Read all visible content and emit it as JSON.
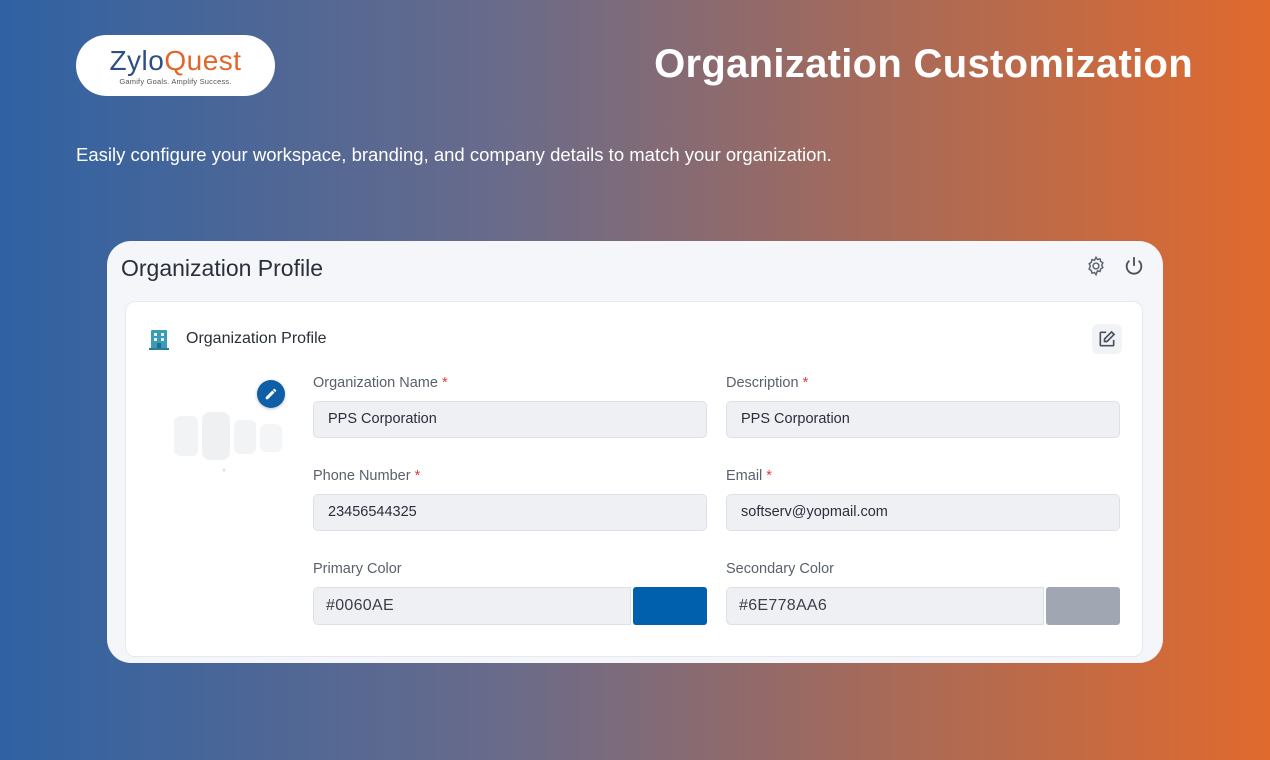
{
  "brand": {
    "logo_part1": "Zylo",
    "logo_part2": "Quest",
    "tagline": "Gamify Goals. Amplify Success."
  },
  "hero": {
    "title": "Organization Customization",
    "subtitle": "Easily configure your workspace, branding, and company details to match your organization."
  },
  "panel": {
    "title": "Organization Profile",
    "header_icons": [
      "gear-icon",
      "power-icon"
    ],
    "section": {
      "title": "Organization Profile",
      "icon": "building-icon",
      "edit_icon": "edit-icon"
    }
  },
  "form": {
    "org_name": {
      "label": "Organization Name",
      "required": "*",
      "value": "PPS Corporation"
    },
    "description": {
      "label": "Description",
      "required": "*",
      "value": "PPS Corporation"
    },
    "phone": {
      "label": "Phone Number",
      "required": "*",
      "value": "23456544325"
    },
    "email": {
      "label": "Email",
      "required": "*",
      "value": "softserv@yopmail.com"
    },
    "primary_color": {
      "label": "Primary Color",
      "value": "#0060AE",
      "swatch": "#0060AE"
    },
    "secondary_color": {
      "label": "Secondary Color",
      "value": "#6E778AA6",
      "swatch": "#6E778AA6"
    }
  },
  "colors": {
    "brand_blue": "#2e4f86",
    "brand_orange": "#e2662b",
    "required": "#e23b3b",
    "avatar_edit": "#0f5ea8"
  }
}
